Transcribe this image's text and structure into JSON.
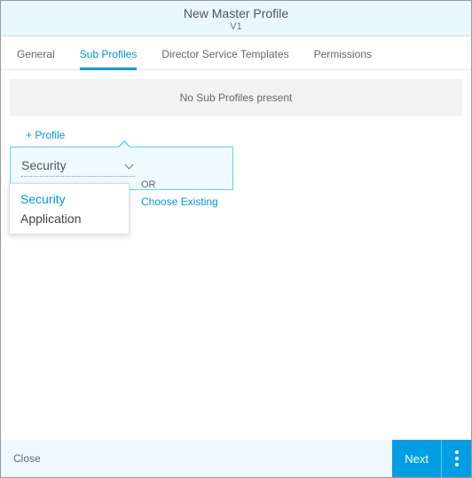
{
  "header": {
    "title": "New Master Profile",
    "version": "V1"
  },
  "tabs": {
    "general": "General",
    "sub_profiles": "Sub Profiles",
    "dst": "Director Service Templates",
    "permissions": "Permissions"
  },
  "content": {
    "no_data": "No Sub Profiles present",
    "add_profile": "+ Profile",
    "select_value": "Security",
    "or_text": "OR",
    "choose_existing": "Choose Existing",
    "dropdown": {
      "option_selected": "Security",
      "option_other": "Application"
    }
  },
  "footer": {
    "close": "Close",
    "next": "Next"
  }
}
